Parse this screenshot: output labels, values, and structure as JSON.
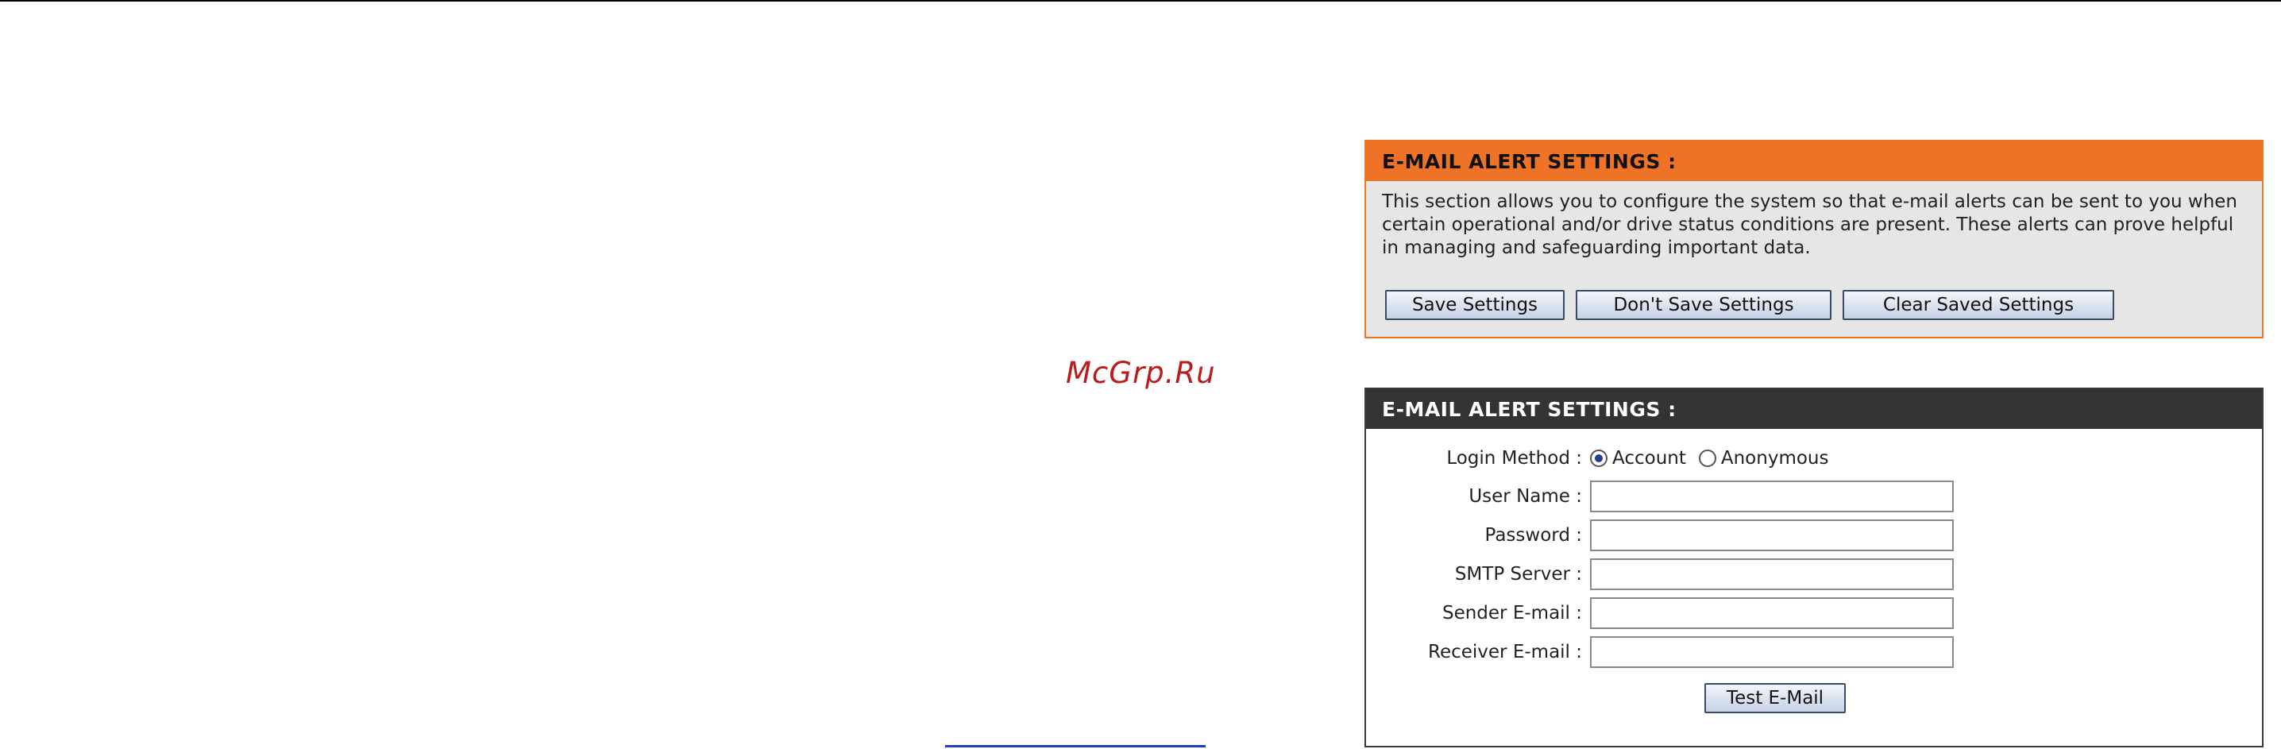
{
  "watermark": "McGrp.Ru",
  "info_panel": {
    "title": "E-MAIL ALERT SETTINGS :",
    "description": "This section allows you to configure the system so that e-mail alerts can be sent to you when certain operational and/or drive status conditions are present. These alerts can prove helpful in managing and safeguarding important data.",
    "buttons": {
      "save": "Save Settings",
      "dont_save": "Don't Save Settings",
      "clear": "Clear Saved Settings"
    }
  },
  "form_panel": {
    "title": "E-MAIL ALERT SETTINGS :",
    "login_method": {
      "label": "Login Method :",
      "options": [
        "Account",
        "Anonymous"
      ],
      "selected": "Account"
    },
    "fields": {
      "user_name": {
        "label": "User Name :",
        "value": ""
      },
      "password": {
        "label": "Password :",
        "value": ""
      },
      "smtp_server": {
        "label": "SMTP Server :",
        "value": ""
      },
      "sender_email": {
        "label": "Sender E-mail :",
        "value": ""
      },
      "receiver_email": {
        "label": "Receiver E-mail :",
        "value": ""
      }
    },
    "test_button": "Test E-Mail"
  },
  "colors": {
    "accent_orange": "#ef7326",
    "header_dark": "#333333",
    "panel_gray": "#e6e6e6",
    "watermark_red": "#b91c1c",
    "link_blue": "#1a3fbf"
  }
}
